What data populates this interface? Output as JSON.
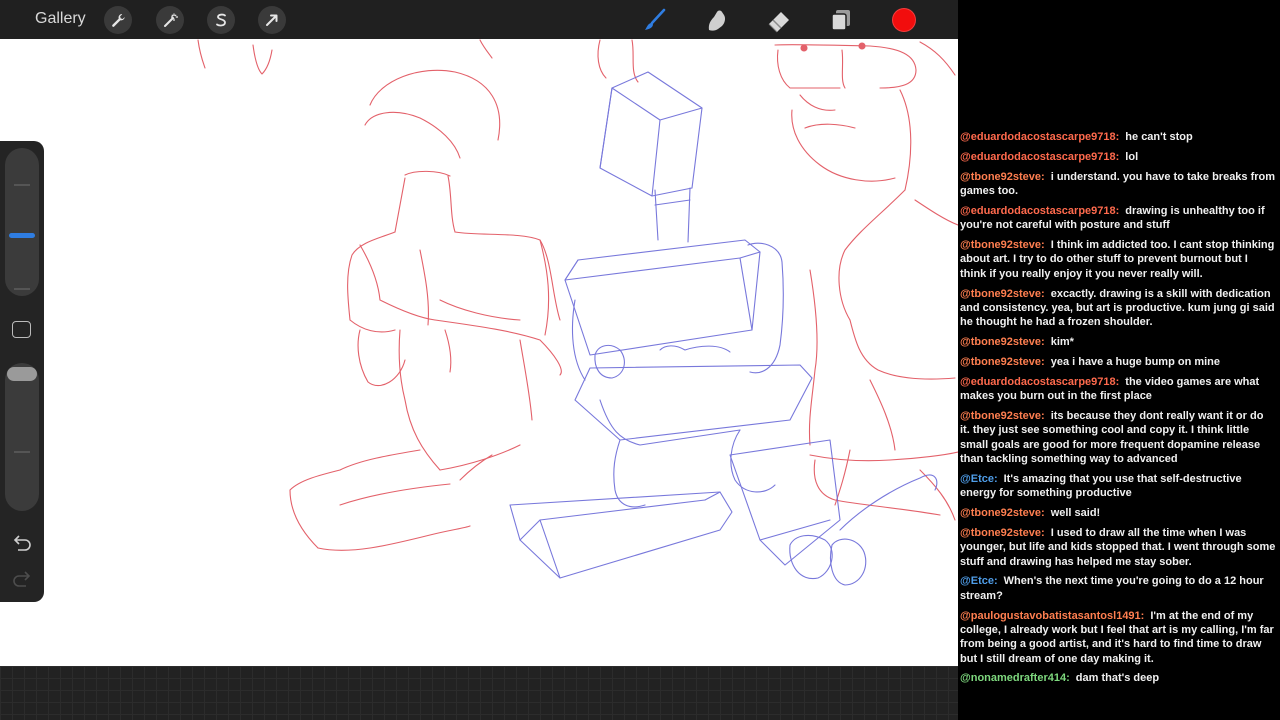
{
  "toolbar": {
    "gallery_label": "Gallery",
    "left_tools": [
      {
        "name": "actions-wrench",
        "icon": "wrench-icon"
      },
      {
        "name": "adjustments-wand",
        "icon": "magic-wand-icon"
      },
      {
        "name": "selection",
        "icon": "selection-s-icon"
      },
      {
        "name": "transform",
        "icon": "arrow-cursor-icon"
      }
    ],
    "right_tools": [
      {
        "name": "brush",
        "icon": "brush-icon",
        "active": true
      },
      {
        "name": "smudge",
        "icon": "smudge-finger-icon"
      },
      {
        "name": "eraser",
        "icon": "eraser-icon"
      },
      {
        "name": "layers",
        "icon": "layers-icon"
      }
    ],
    "active_color": "#f20d0d",
    "active_tool_color": "#2f7de1"
  },
  "sidebar": {
    "brush_size_level": 0.62,
    "opacity_level": 1.0,
    "modify_icon": "square-icon",
    "undo_icon": "undo-arrow-icon",
    "redo_icon": "redo-arrow-icon"
  },
  "sketch_colors": {
    "figure": "#e0505a",
    "robot": "#6a6ad8"
  },
  "chat": {
    "messages": [
      {
        "user": "@eduardodacostascarpe9718:",
        "user_color": "#ff6a4d",
        "text": "he can't stop"
      },
      {
        "user": "@eduardodacostascarpe9718:",
        "user_color": "#ff6a4d",
        "text": "lol"
      },
      {
        "user": "@tbone92steve:",
        "user_color": "#ff7f50",
        "text": "i understand. you have to take breaks from games too."
      },
      {
        "user": "@eduardodacostascarpe9718:",
        "user_color": "#ff6a4d",
        "text": "drawing is unhealthy too if you're not careful with posture and stuff"
      },
      {
        "user": "@tbone92steve:",
        "user_color": "#ff7f50",
        "text": "I think im addicted too. I cant stop thinking about art. I try to do other stuff to prevent burnout but I think if you really enjoy it you never really will."
      },
      {
        "user": "@tbone92steve:",
        "user_color": "#ff7f50",
        "text": "excactly. drawing is a skill with dedication and consistency. yea, but art is productive. kum jung gi said he thought he had a frozen shoulder."
      },
      {
        "user": "@tbone92steve:",
        "user_color": "#ff7f50",
        "text": "kim*"
      },
      {
        "user": "@tbone92steve:",
        "user_color": "#ff7f50",
        "text": "yea i have a huge bump on mine"
      },
      {
        "user": "@eduardodacostascarpe9718:",
        "user_color": "#ff6a4d",
        "text": "the video games are what makes you burn out in the first place"
      },
      {
        "user": "@tbone92steve:",
        "user_color": "#ff7f50",
        "text": "its because they dont really want it or do it. they just see something cool and copy it. I think little small goals are good for more frequent dopamine release than tackling something way to advanced"
      },
      {
        "user": "@Etce:",
        "user_color": "#4f9de8",
        "text": "It's amazing that you use that self-destructive energy for something productive"
      },
      {
        "user": "@tbone92steve:",
        "user_color": "#ff7f50",
        "text": "well said!"
      },
      {
        "user": "@tbone92steve:",
        "user_color": "#ff7f50",
        "text": "I used to draw all the time when I was younger, but life and kids stopped that. I went through some stuff and drawing has helped me stay sober."
      },
      {
        "user": "@Etce:",
        "user_color": "#4f9de8",
        "text": "When's the next time you're going to do a 12 hour stream?"
      },
      {
        "user": "@paulogustavobatistasantosl1491:",
        "user_color": "#ff7f50",
        "text": "I'm at the end of my college, I already work but I feel that art is my calling, I'm far from being a good artist, and it's hard to find time to draw but I still dream of one day making it."
      },
      {
        "user": "@nonamedrafter414:",
        "user_color": "#7ed87e",
        "text": "dam that's deep"
      }
    ]
  }
}
